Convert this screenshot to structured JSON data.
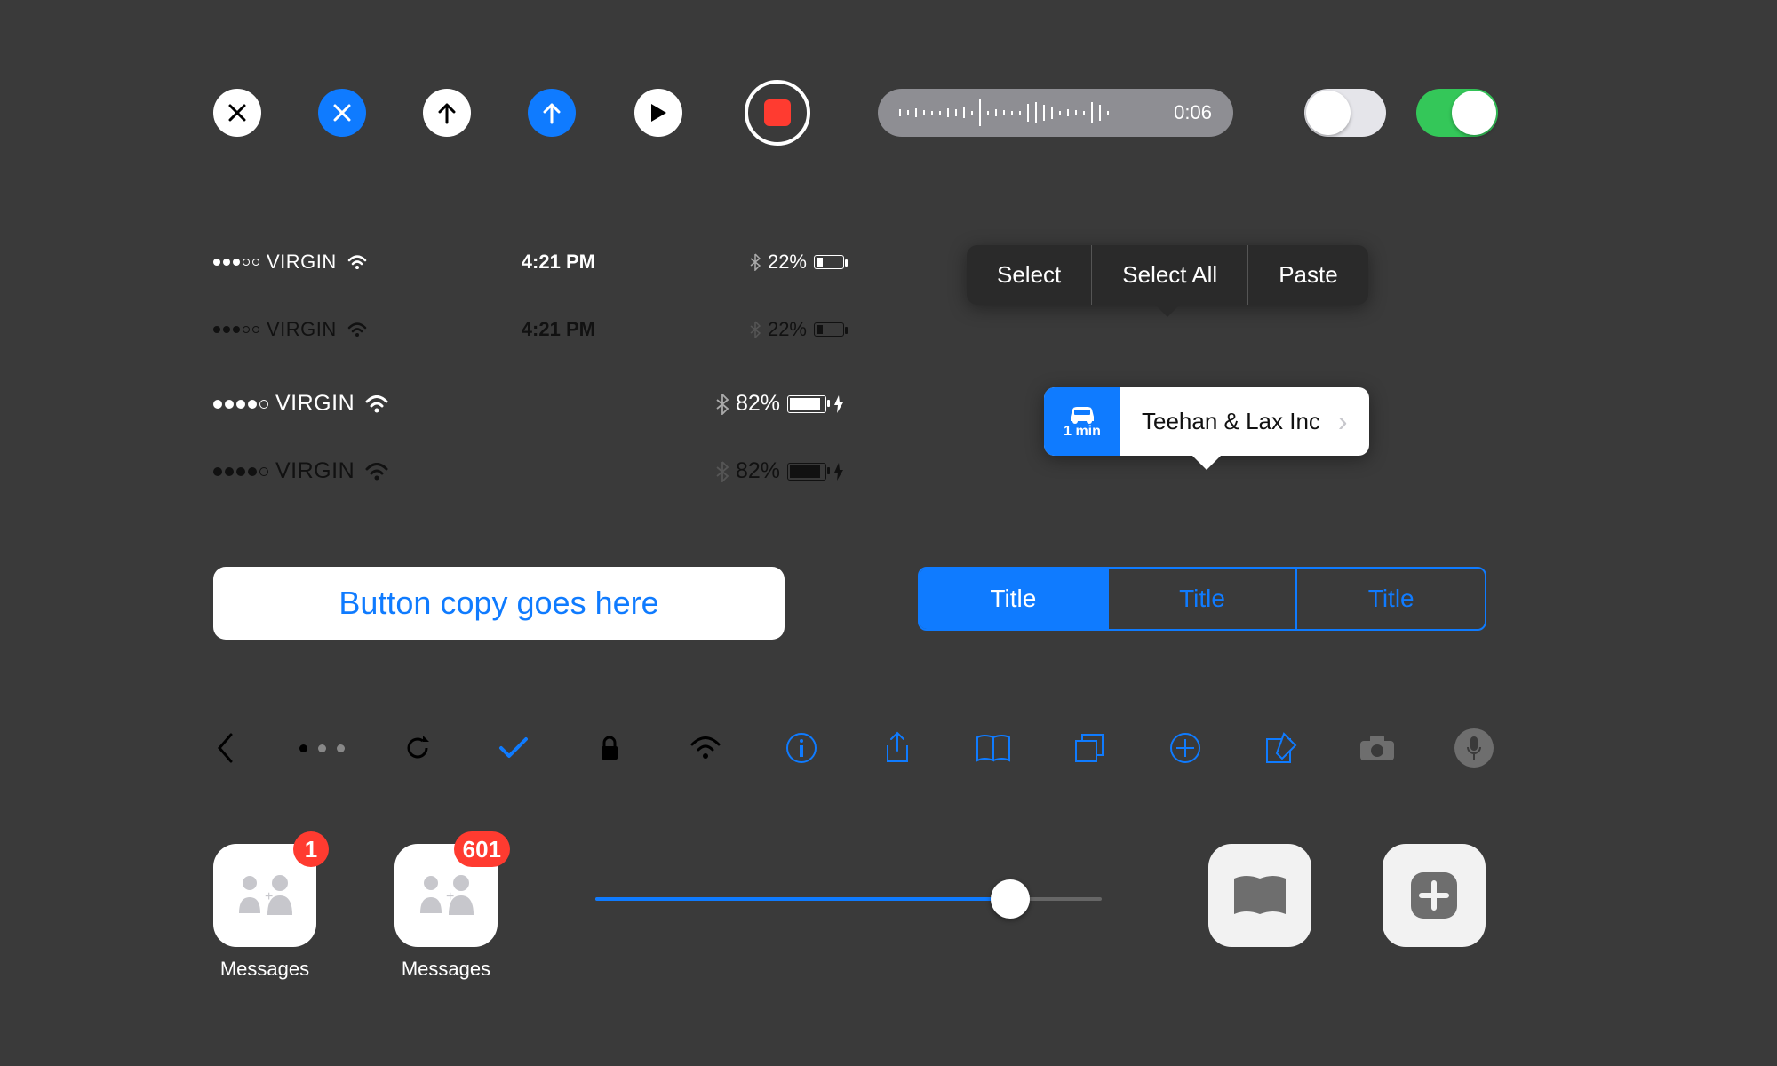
{
  "buttons_row": {
    "close_white": "close",
    "close_blue": "close",
    "up_white": "up",
    "up_blue": "up",
    "play": "play",
    "record": "record"
  },
  "waveform": {
    "duration": "0:06"
  },
  "toggles": {
    "off": false,
    "on": true
  },
  "status_bars": [
    {
      "carrier": "VIRGIN",
      "signal_filled": 3,
      "signal_total": 5,
      "time": "4:21 PM",
      "battery_pct": "22%",
      "battery_level": 0.22,
      "charging": false,
      "variant": "light-small"
    },
    {
      "carrier": "VIRGIN",
      "signal_filled": 3,
      "signal_total": 5,
      "time": "4:21 PM",
      "battery_pct": "22%",
      "battery_level": 0.22,
      "charging": false,
      "variant": "dark-small"
    },
    {
      "carrier": "VIRGIN",
      "signal_filled": 4,
      "signal_total": 5,
      "time": "",
      "battery_pct": "82%",
      "battery_level": 0.82,
      "charging": true,
      "variant": "light-big"
    },
    {
      "carrier": "VIRGIN",
      "signal_filled": 4,
      "signal_total": 5,
      "time": "",
      "battery_pct": "82%",
      "battery_level": 0.82,
      "charging": true,
      "variant": "dark-big"
    }
  ],
  "edit_menu": {
    "items": [
      "Select",
      "Select All",
      "Paste"
    ]
  },
  "map_callout": {
    "eta": "1 min",
    "title": "Teehan & Lax Inc"
  },
  "big_button": {
    "label": "Button copy goes here"
  },
  "segmented": {
    "items": [
      "Title",
      "Title",
      "Title"
    ],
    "selected_index": 0
  },
  "icon_row": {
    "page_dots": {
      "count": 3,
      "active": 0
    },
    "icons": [
      "back",
      "page-dots",
      "refresh",
      "checkmark",
      "lock",
      "wifi",
      "info",
      "share",
      "book",
      "tabs",
      "add-circle",
      "compose",
      "camera",
      "microphone"
    ]
  },
  "app_icons": [
    {
      "label": "Messages",
      "badge": "1"
    },
    {
      "label": "Messages",
      "badge": "601"
    }
  ],
  "slider": {
    "value": 0.82
  },
  "dock_icons": [
    "book",
    "add"
  ],
  "colors": {
    "accent": "#0f7bff",
    "danger": "#ff3b30",
    "success": "#34c759"
  }
}
